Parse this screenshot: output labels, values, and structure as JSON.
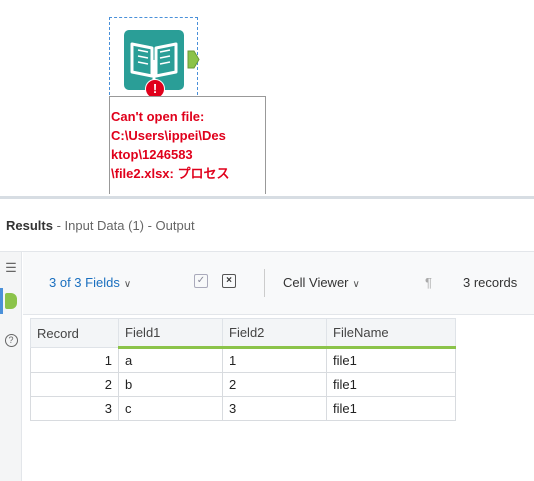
{
  "canvas": {
    "tool_icon": "input-data-book-icon",
    "error_badge": "!",
    "error_lines": [
      "Can't open file:",
      "C:\\Users\\ippei\\Des",
      "ktop\\1246583",
      "\\file2.xlsx: プロセス"
    ]
  },
  "results": {
    "title_bold": "Results",
    "title_rest": " - Input Data (1) - Output",
    "toolbar": {
      "fields_label": "3 of 3 Fields",
      "cell_viewer_label": "Cell Viewer",
      "pilcrow": "¶",
      "records_label": "3 records"
    },
    "columns": [
      "Record",
      "Field1",
      "Field2",
      "FileName"
    ],
    "rows": [
      {
        "record": "1",
        "field1": "a",
        "field2": "1",
        "filename": "file1"
      },
      {
        "record": "2",
        "field1": "b",
        "field2": "2",
        "filename": "file1"
      },
      {
        "record": "3",
        "field1": "c",
        "field2": "3",
        "filename": "file1"
      }
    ]
  },
  "colors": {
    "error_red": "#e0001b",
    "tool_teal": "#2a9e97",
    "anchor_green": "#8bc34a",
    "link_blue": "#1a6fbf"
  }
}
